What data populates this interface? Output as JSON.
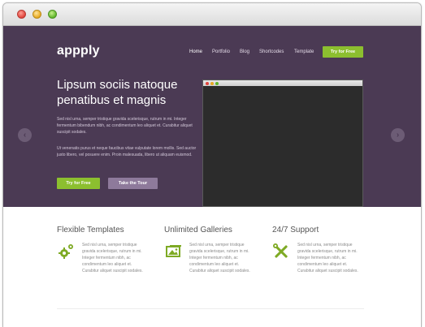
{
  "app": {
    "name": "appply"
  },
  "nav": {
    "items": [
      {
        "label": "Home",
        "active": true
      },
      {
        "label": "Portfolio",
        "active": false
      },
      {
        "label": "Blog",
        "active": false
      },
      {
        "label": "Shortcodes",
        "active": false
      },
      {
        "label": "Template",
        "active": false
      }
    ],
    "cta_label": "Try for Free"
  },
  "hero": {
    "headline": "Lipsum sociis natoque penatibus et magnis",
    "paragraph_1": "Sed nisl urna, semper tristique gravida scelerisque, rutrum in mi. Integer fermentum bibendum nibh, ac condimentum leo aliquet et. Curabitur aliquet suscipit sodales.",
    "paragraph_2": "Ut venenatis purus et neque faucibus vitae vulputate lorem mollis. Sed auctor justo libero, vel posuere enim. Proin malesuada, libero ut aliquam euismod.",
    "primary_button": "Try for Free",
    "secondary_button": "Take the Tour",
    "prev_arrow": "‹",
    "next_arrow": "›"
  },
  "features": [
    {
      "title": "Flexible Templates",
      "icon": "gears-icon",
      "text": "Sed nisl urna, semper tristique gravida scelerisque, rutrum in mi. Integer fermentum nibh, ac condimentum leo aliquet et. Curabitur aliquet suscipit sodales."
    },
    {
      "title": "Unlimited Galleries",
      "icon": "image-icon",
      "text": "Sed nisl urna, semper tristique gravida scelerisque, rutrum in mi. Integer fermentum nibh, ac condimentum leo aliquet et. Curabitur aliquet suscipit sodales."
    },
    {
      "title": "24/7 Support",
      "icon": "tools-icon",
      "text": "Sed nisl urna, semper tristique gravida scelerisque, rutrum in mi. Integer fermentum nibh, ac condimentum leo aliquet et. Curabitur aliquet suscipit sodales."
    }
  ],
  "colors": {
    "hero_bg": "#4b3a54",
    "accent_green": "#8cbf2f",
    "secondary_purple": "#8e7a9b"
  }
}
